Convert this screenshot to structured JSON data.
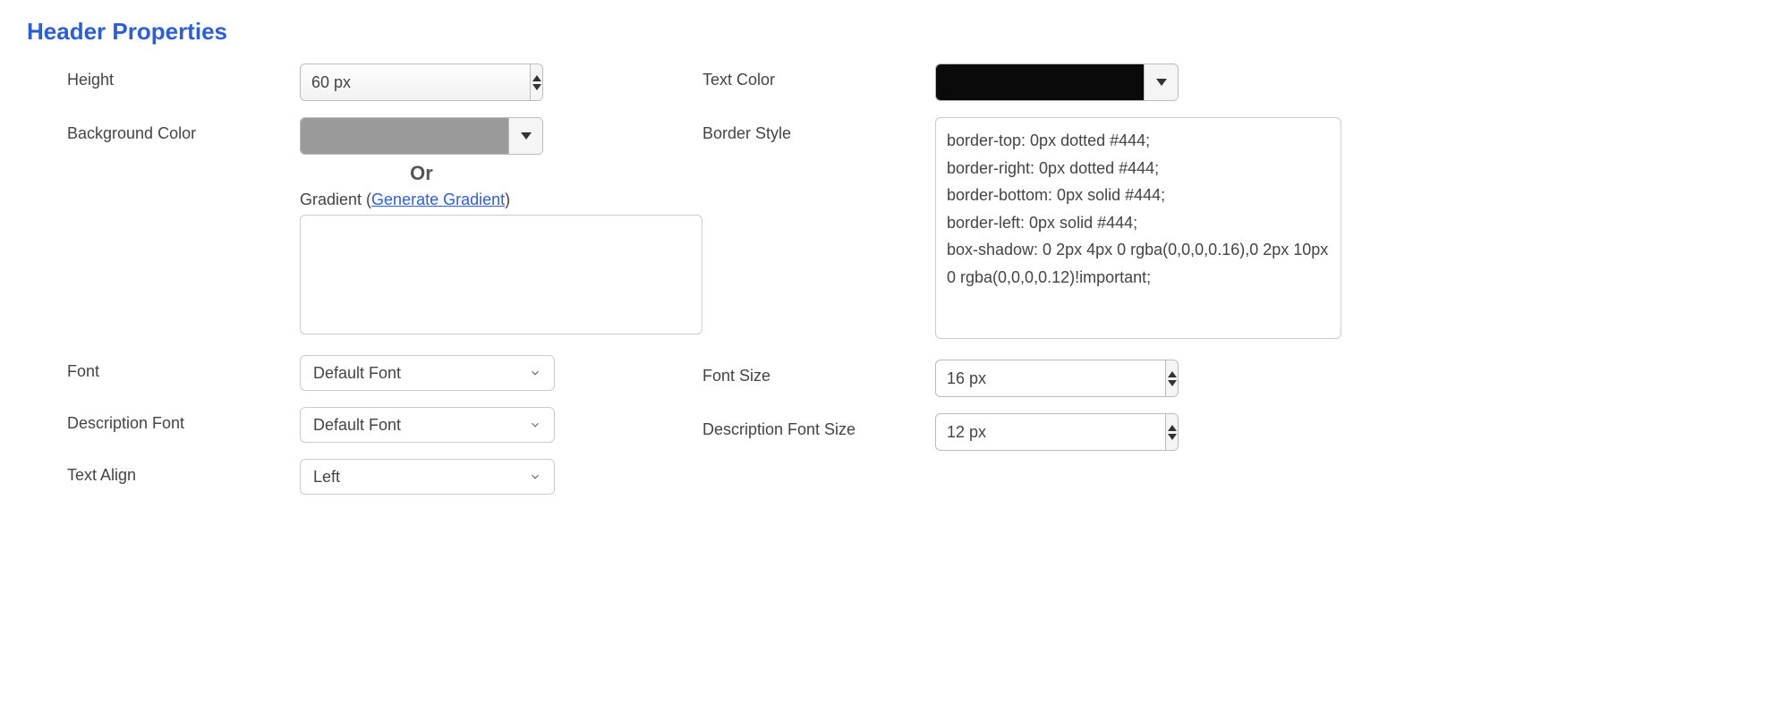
{
  "section_title": "Header Properties",
  "labels": {
    "height": "Height",
    "background_color": "Background Color",
    "font": "Font",
    "description_font": "Description Font",
    "text_align": "Text Align",
    "text_color": "Text Color",
    "border_style": "Border Style",
    "font_size": "Font Size",
    "description_font_size": "Description Font Size"
  },
  "values": {
    "height": "60 px",
    "background_color": "#9a9a9a",
    "or_text": "Or",
    "gradient_prefix": "Gradient (",
    "gradient_link": "Generate Gradient",
    "gradient_suffix": ")",
    "gradient_value": "",
    "font": "Default Font",
    "description_font": "Default Font",
    "text_align": "Left",
    "text_color": "#0a0a0a",
    "border_style": "border-top: 0px dotted #444;\nborder-right: 0px dotted #444;\nborder-bottom: 0px solid #444;\nborder-left: 0px solid #444;\nbox-shadow: 0 2px 4px 0 rgba(0,0,0,0.16),0 2px 10px 0 rgba(0,0,0,0.12)!important;",
    "font_size": "16 px",
    "description_font_size": "12 px"
  }
}
